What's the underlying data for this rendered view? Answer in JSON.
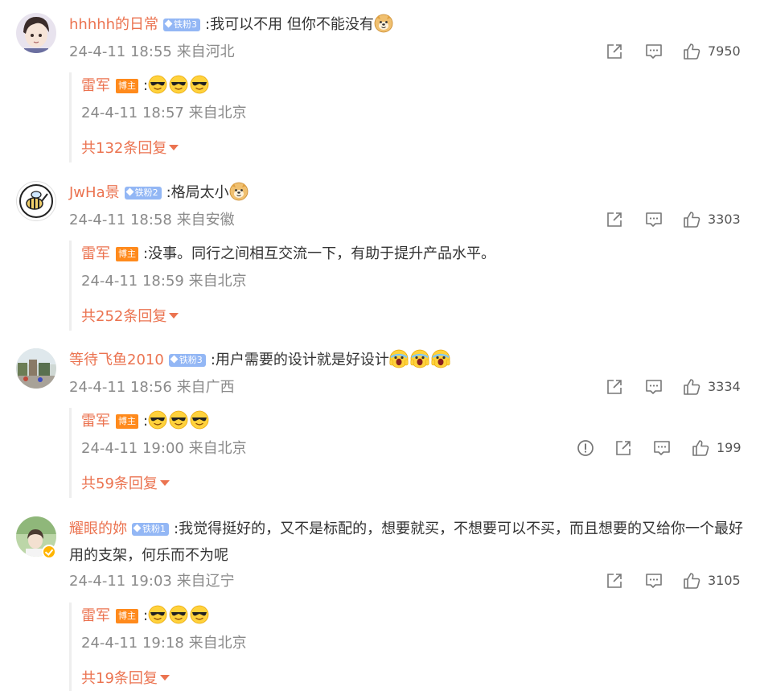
{
  "colors": {
    "username": "#eb7350",
    "meta": "#8a8a8a",
    "text": "#333333",
    "fan_badge": "#93b7f5",
    "host_badge": "#ff8a1c"
  },
  "comments": [
    {
      "username": "hhhhh的日常",
      "fan_badge": "铁粉3",
      "text": ":我可以不用  但你不能没有",
      "emojis": [
        "doge-emoji"
      ],
      "meta": "24-4-11 18:55 来自河北",
      "likes": "7950",
      "reply": {
        "username": "雷军",
        "badge": "博主",
        "text": ":",
        "emojis": [
          "sunglasses-emoji",
          "sunglasses-emoji",
          "sunglasses-emoji"
        ],
        "meta": "24-4-11 18:57 来自北京"
      },
      "more_replies": "共132条回复"
    },
    {
      "username": "JwHa景",
      "fan_badge": "铁粉2",
      "text": ":格局太小",
      "emojis": [
        "doge-emoji"
      ],
      "meta": "24-4-11 18:58 来自安徽",
      "likes": "3303",
      "reply": {
        "username": "雷军",
        "badge": "博主",
        "text": ":没事。同行之间相互交流一下，有助于提升产品水平。",
        "emojis": [],
        "meta": "24-4-11 18:59 来自北京"
      },
      "more_replies": "共252条回复"
    },
    {
      "username": "等待飞鱼2010",
      "fan_badge": "铁粉3",
      "text": ":用户需要的设计就是好设计",
      "emojis": [
        "scream-emoji",
        "scream-emoji",
        "scream-emoji"
      ],
      "meta": "24-4-11 18:56 来自广西",
      "likes": "3334",
      "reply": {
        "username": "雷军",
        "badge": "博主",
        "text": ":",
        "emojis": [
          "sunglasses-emoji",
          "sunglasses-emoji",
          "sunglasses-emoji"
        ],
        "meta": "24-4-11 19:00 来自北京",
        "likes": "199"
      },
      "more_replies": "共59条回复"
    },
    {
      "username": "耀眼的妳",
      "fan_badge": "铁粉1",
      "text": ":我觉得挺好的，又不是标配的，想要就买，不想要可以不买，而且想要的又给你一个最好用的支架，何乐而不为呢",
      "emojis": [],
      "meta": "24-4-11 19:03 来自辽宁",
      "likes": "3105",
      "reply": {
        "username": "雷军",
        "badge": "博主",
        "text": ":",
        "emojis": [
          "sunglasses-emoji",
          "sunglasses-emoji",
          "sunglasses-emoji"
        ],
        "meta": "24-4-11 19:18 来自北京"
      },
      "more_replies": "共19条回复"
    }
  ]
}
